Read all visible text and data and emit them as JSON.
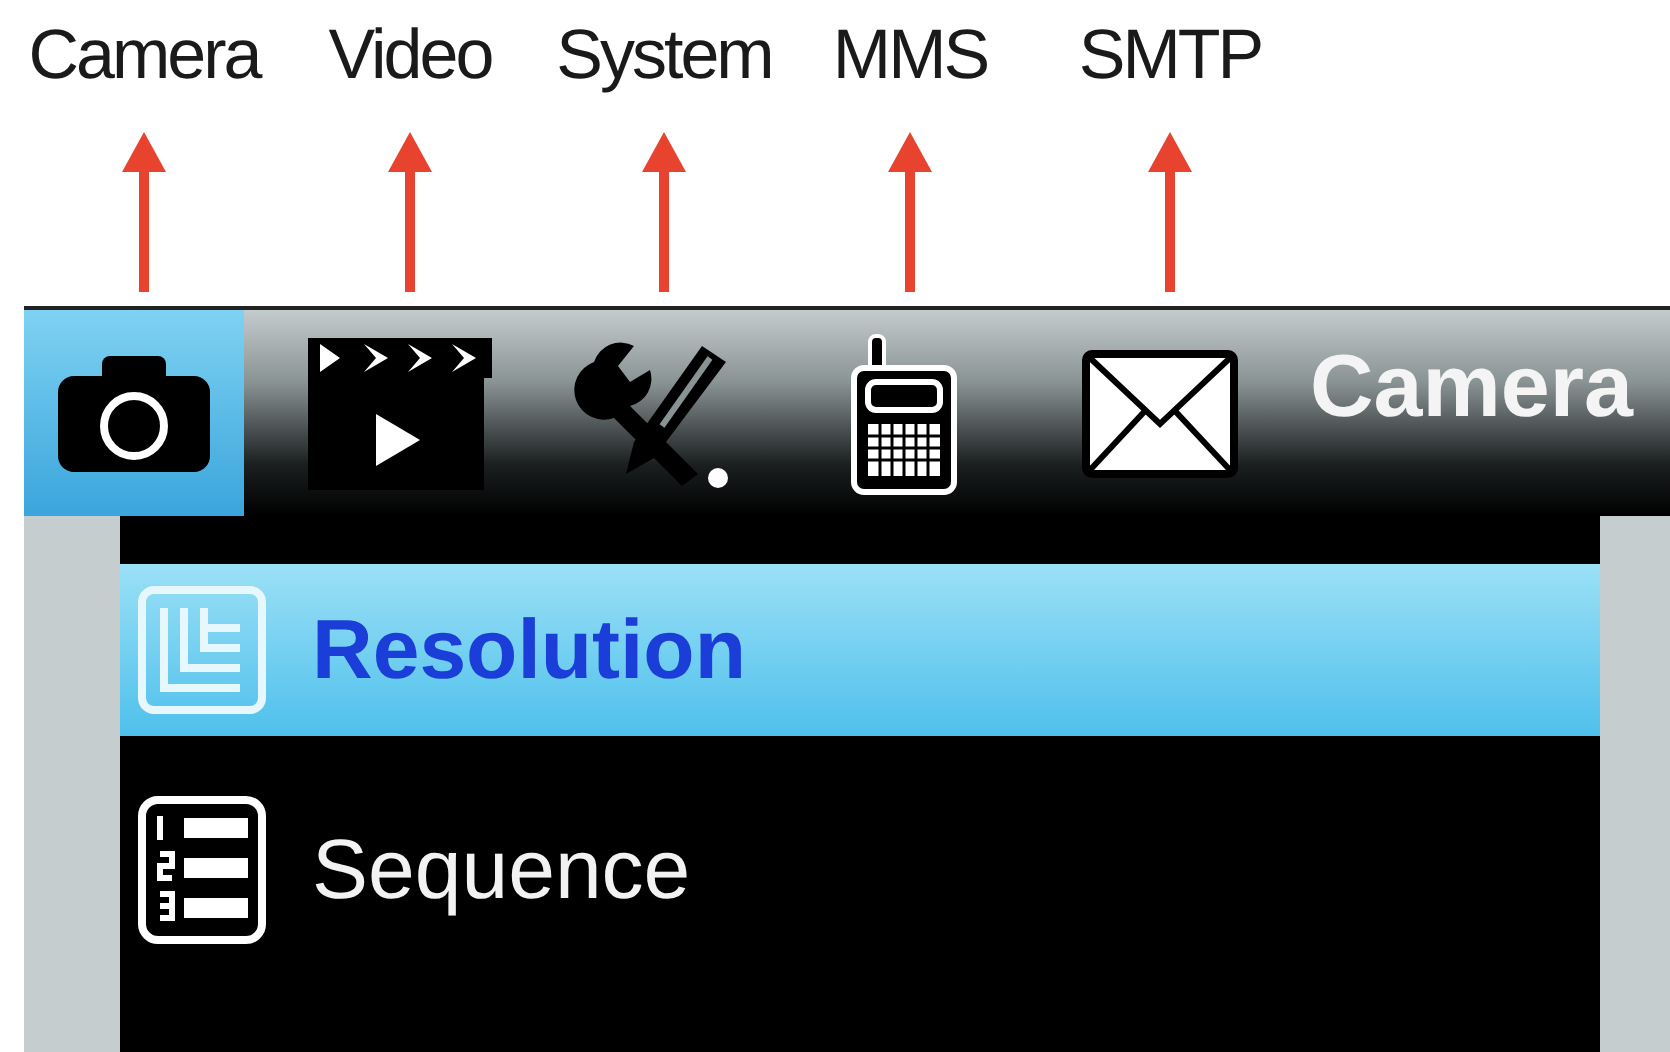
{
  "callouts": [
    {
      "label": "Camera"
    },
    {
      "label": "Video"
    },
    {
      "label": "System"
    },
    {
      "label": "MMS"
    },
    {
      "label": "SMTP"
    }
  ],
  "tabs": [
    {
      "kind": "camera",
      "selected": true
    },
    {
      "kind": "video",
      "selected": false
    },
    {
      "kind": "system",
      "selected": false
    },
    {
      "kind": "mms",
      "selected": false
    },
    {
      "kind": "smtp",
      "selected": false
    }
  ],
  "title": "Camera",
  "menu": [
    {
      "label": "Resolution",
      "kind": "resolution",
      "selected": true
    },
    {
      "label": "Sequence",
      "kind": "sequence",
      "selected": false
    }
  ]
}
